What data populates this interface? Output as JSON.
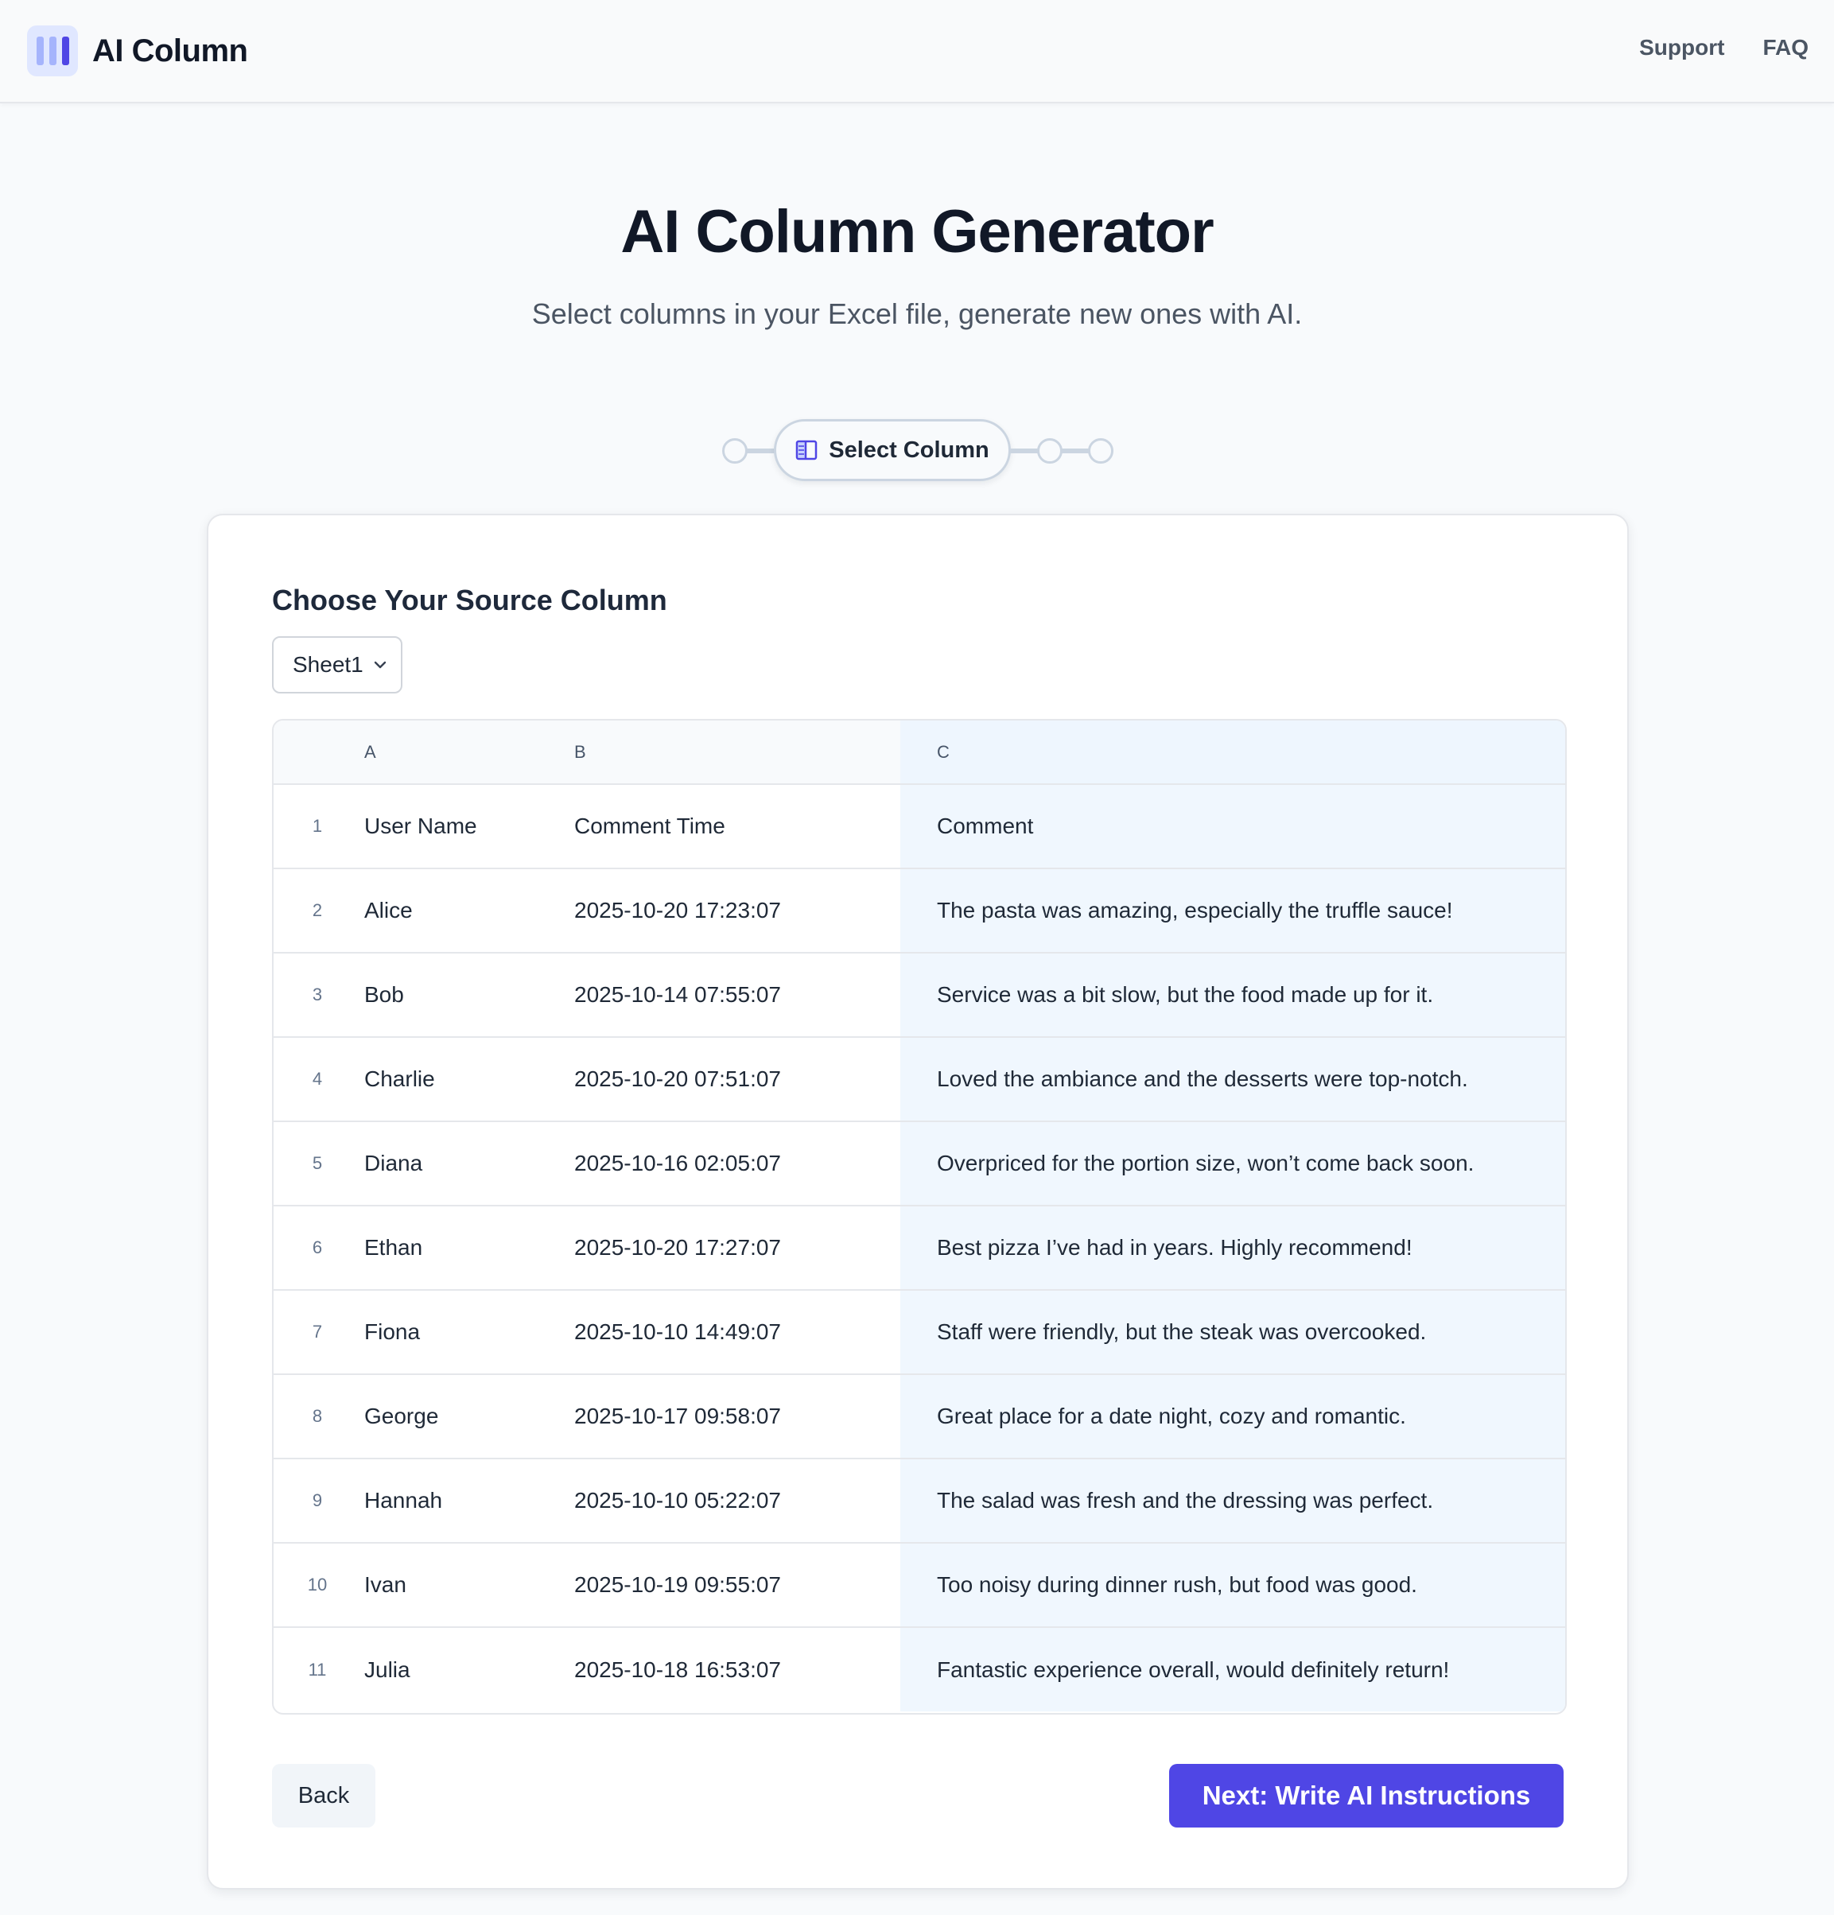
{
  "header": {
    "app_name": "AI Column",
    "nav": [
      "Support",
      "FAQ"
    ]
  },
  "hero": {
    "title": "AI Column Generator",
    "subtitle": "Select columns in your Excel file, generate new ones with AI."
  },
  "stepper": {
    "active_step_label": "Select Column",
    "total_steps": 4,
    "active_step_index": 2
  },
  "card": {
    "title": "Choose Your Source Column",
    "sheet_select": {
      "value": "Sheet1"
    },
    "table": {
      "column_letters": [
        "A",
        "B",
        "C"
      ],
      "selected_column": "C",
      "rows": [
        {
          "num": "1",
          "a": "User Name",
          "b": "Comment Time",
          "c": "Comment"
        },
        {
          "num": "2",
          "a": "Alice",
          "b": "2025-10-20 17:23:07",
          "c": "The pasta was amazing, especially the truffle sauce!"
        },
        {
          "num": "3",
          "a": "Bob",
          "b": "2025-10-14 07:55:07",
          "c": "Service was a bit slow, but the food made up for it."
        },
        {
          "num": "4",
          "a": "Charlie",
          "b": "2025-10-20 07:51:07",
          "c": "Loved the ambiance and the desserts were top-notch."
        },
        {
          "num": "5",
          "a": "Diana",
          "b": "2025-10-16 02:05:07",
          "c": "Overpriced for the portion size, won’t come back soon."
        },
        {
          "num": "6",
          "a": "Ethan",
          "b": "2025-10-20 17:27:07",
          "c": "Best pizza I’ve had in years. Highly recommend!"
        },
        {
          "num": "7",
          "a": "Fiona",
          "b": "2025-10-10 14:49:07",
          "c": "Staff were friendly, but the steak was overcooked."
        },
        {
          "num": "8",
          "a": "George",
          "b": "2025-10-17 09:58:07",
          "c": "Great place for a date night, cozy and romantic."
        },
        {
          "num": "9",
          "a": "Hannah",
          "b": "2025-10-10 05:22:07",
          "c": "The salad was fresh and the dressing was perfect."
        },
        {
          "num": "10",
          "a": "Ivan",
          "b": "2025-10-19 09:55:07",
          "c": "Too noisy during dinner rush, but food was good."
        },
        {
          "num": "11",
          "a": "Julia",
          "b": "2025-10-18 16:53:07",
          "c": "Fantastic experience overall, would definitely return!"
        }
      ]
    },
    "buttons": {
      "back_label": "Back",
      "next_label": "Next: Write AI Instructions"
    }
  },
  "icons": {
    "logo": "columns-logo-icon",
    "step": "column-select-icon",
    "select_chevron": "chevron-down-icon"
  },
  "colors": {
    "accent": "#4f46e5",
    "selected_column_bg": "#f0f7fe",
    "logo_bg": "#e0e7ff"
  }
}
